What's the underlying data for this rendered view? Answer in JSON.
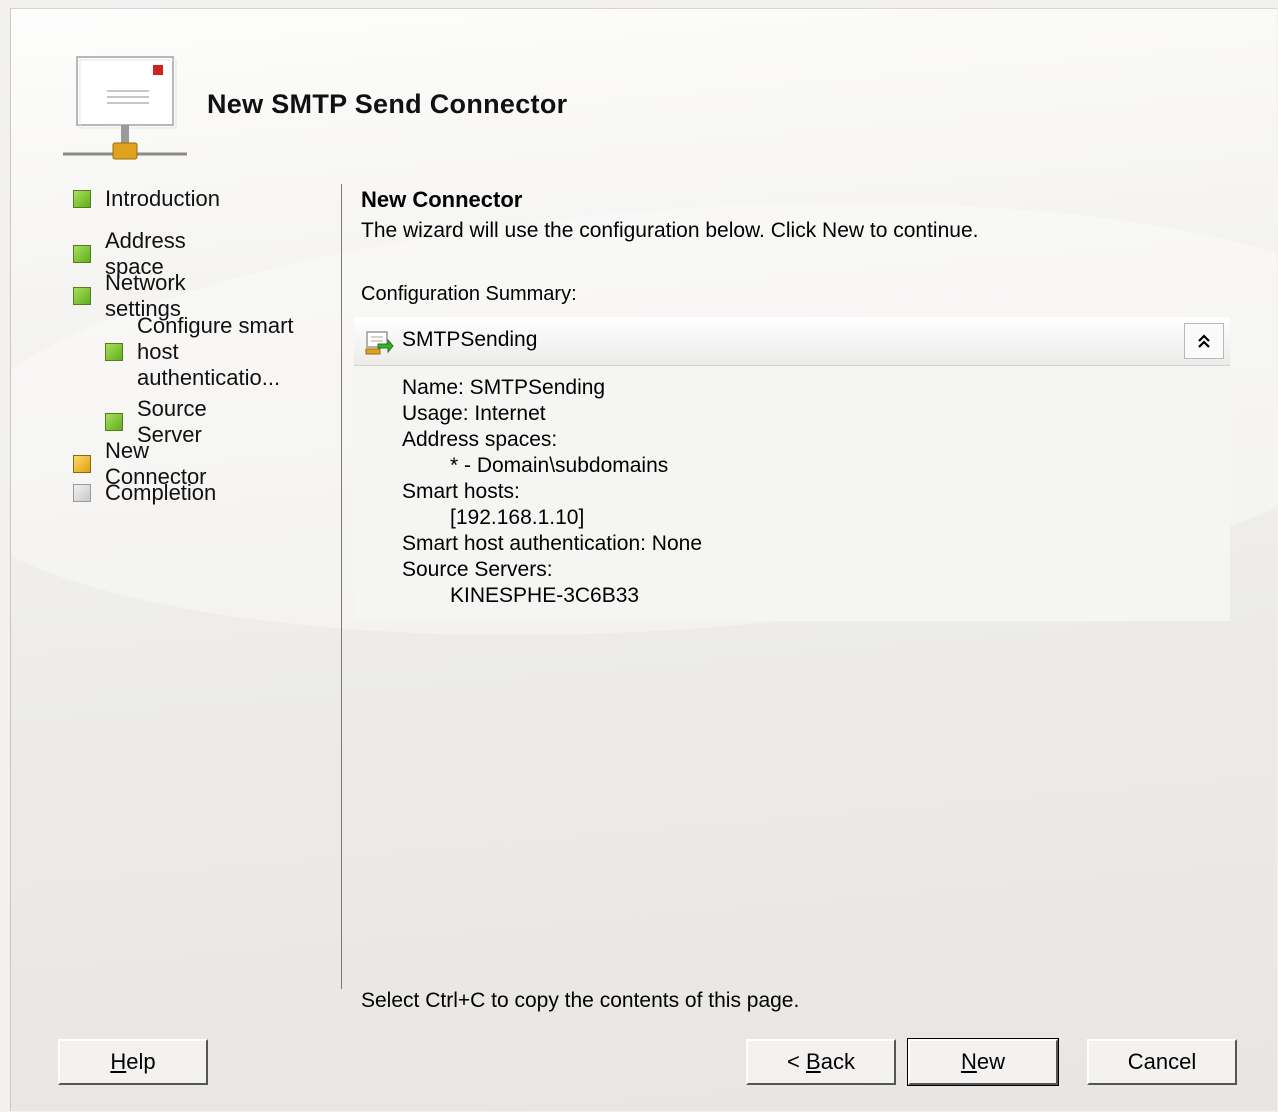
{
  "window": {
    "title": "New SMTP Send Connector"
  },
  "steps": [
    {
      "label": "Introduction",
      "state": "complete"
    },
    {
      "label": "Address space",
      "state": "complete"
    },
    {
      "label": "Network settings",
      "state": "complete"
    },
    {
      "label_line1": "Configure smart",
      "label_line2": "host authenticatio...",
      "state": "complete"
    },
    {
      "label": "Source Server",
      "state": "complete"
    },
    {
      "label": "New Connector",
      "state": "current"
    },
    {
      "label": "Completion",
      "state": "pending"
    }
  ],
  "page": {
    "heading": "New Connector",
    "description": "The wizard will use the configuration below.  Click New to continue.",
    "summary_label": "Configuration Summary:",
    "copy_hint": "Select Ctrl+C to copy the contents of this page."
  },
  "summary": {
    "title": "SMTPSending",
    "collapse_glyph": "⌃",
    "lines": {
      "name": "Name: SMTPSending",
      "usage": "Usage: Internet",
      "address_spaces_label": "Address spaces:",
      "address_space_1": "* - Domain\\subdomains",
      "smart_hosts_label": "Smart hosts:",
      "smart_host_1": "[192.168.1.10]",
      "smart_host_auth": "Smart host authentication: None",
      "source_servers_label": "Source Servers:",
      "source_server_1": "KINESPHE-3C6B33"
    }
  },
  "buttons": {
    "help": {
      "prefix": "",
      "mnemonic": "H",
      "rest": "elp"
    },
    "back": {
      "prefix": "< ",
      "mnemonic": "B",
      "rest": "ack"
    },
    "new": {
      "prefix": "",
      "mnemonic": "N",
      "rest": "ew"
    },
    "cancel": {
      "label": "Cancel"
    }
  },
  "colors": {
    "complete": "#6cbd22",
    "current": "#f0b020",
    "pending": "#d0d0d0"
  }
}
